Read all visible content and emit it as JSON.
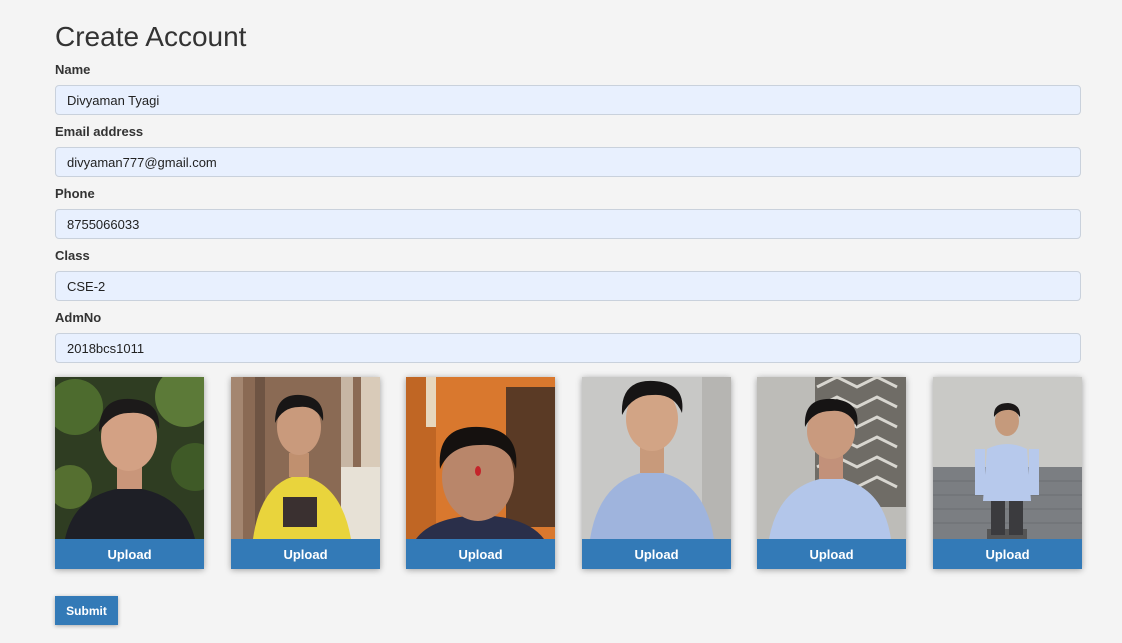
{
  "page": {
    "title": "Create Account"
  },
  "form": {
    "fields": [
      {
        "label": "Name",
        "value": "Divyaman Tyagi"
      },
      {
        "label": "Email address",
        "value": "divyaman777@gmail.com"
      },
      {
        "label": "Phone",
        "value": "8755066033"
      },
      {
        "label": "Class",
        "value": "CSE-2"
      },
      {
        "label": "AdmNo",
        "value": "2018bcs1011"
      }
    ]
  },
  "photos": {
    "upload_label": "Upload",
    "count": 6
  },
  "submit_label": "Submit",
  "colors": {
    "primary": "#337ab7",
    "input_bg": "#e8f0fe",
    "page_bg": "#f4f4f4"
  }
}
